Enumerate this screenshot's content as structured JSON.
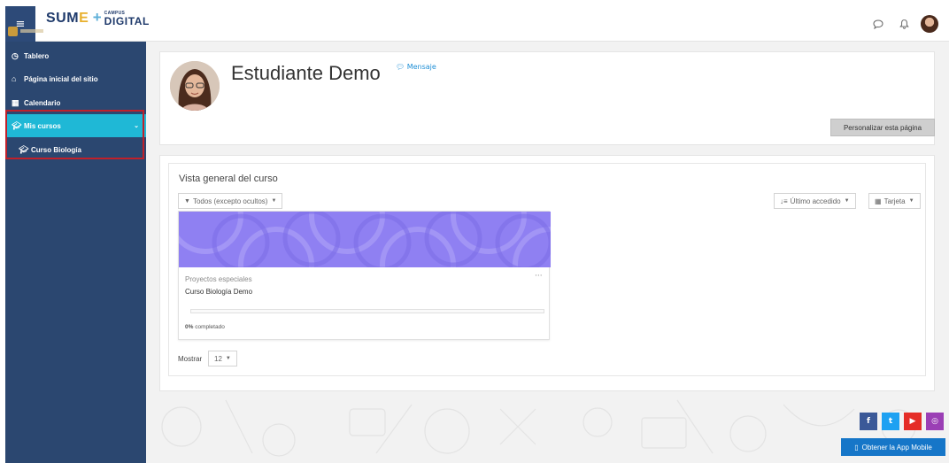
{
  "brand": {
    "name_part1": "SUM",
    "name_part2": "E",
    "plus": "+",
    "campus": "CAMPUS",
    "digital": "DIGITAL"
  },
  "header": {
    "menu_icon": "hamburger-icon",
    "chat_icon": "chat-icon",
    "bell_icon": "bell-icon"
  },
  "sidebar": {
    "items": [
      {
        "label": "Tablero",
        "icon": "dashboard-icon"
      },
      {
        "label": "Página inicial del sitio",
        "icon": "home-icon"
      },
      {
        "label": "Calendario",
        "icon": "calendar-icon"
      },
      {
        "label": "Mis cursos",
        "icon": "graduation-cap-icon"
      },
      {
        "label": "Curso Biología",
        "icon": "graduation-cap-icon"
      }
    ]
  },
  "profile": {
    "name": "Estudiante Demo",
    "message_link": "Mensaje",
    "customize_button": "Personalizar esta página"
  },
  "overview": {
    "title": "Vista general del curso",
    "filter": "Todos (excepto ocultos)",
    "sort": "Último accedido",
    "view": "Tarjeta",
    "course": {
      "category": "Proyectos especiales",
      "name": "Curso Biología Demo",
      "progress_percent": 0,
      "progress_label_num": "0%",
      "progress_label_text": " completado",
      "menu": "···"
    },
    "show_label": "Mostrar",
    "show_value": "12"
  },
  "footer": {
    "social": [
      {
        "icon": "facebook-icon",
        "glyph": "f",
        "color": "#3b5998"
      },
      {
        "icon": "twitter-icon",
        "glyph": "t",
        "color": "#1da1f2"
      },
      {
        "icon": "youtube-icon",
        "glyph": "▶",
        "color": "#e52d27"
      },
      {
        "icon": "instagram-icon",
        "glyph": "◎",
        "color": "#9b3fb5"
      }
    ],
    "app_button": "Obtener la App Mobile"
  },
  "colors": {
    "sidebar": "#2b4770",
    "accent": "#1fb8d6",
    "course_image": "#8f80f2",
    "highlight": "#c0202a"
  }
}
